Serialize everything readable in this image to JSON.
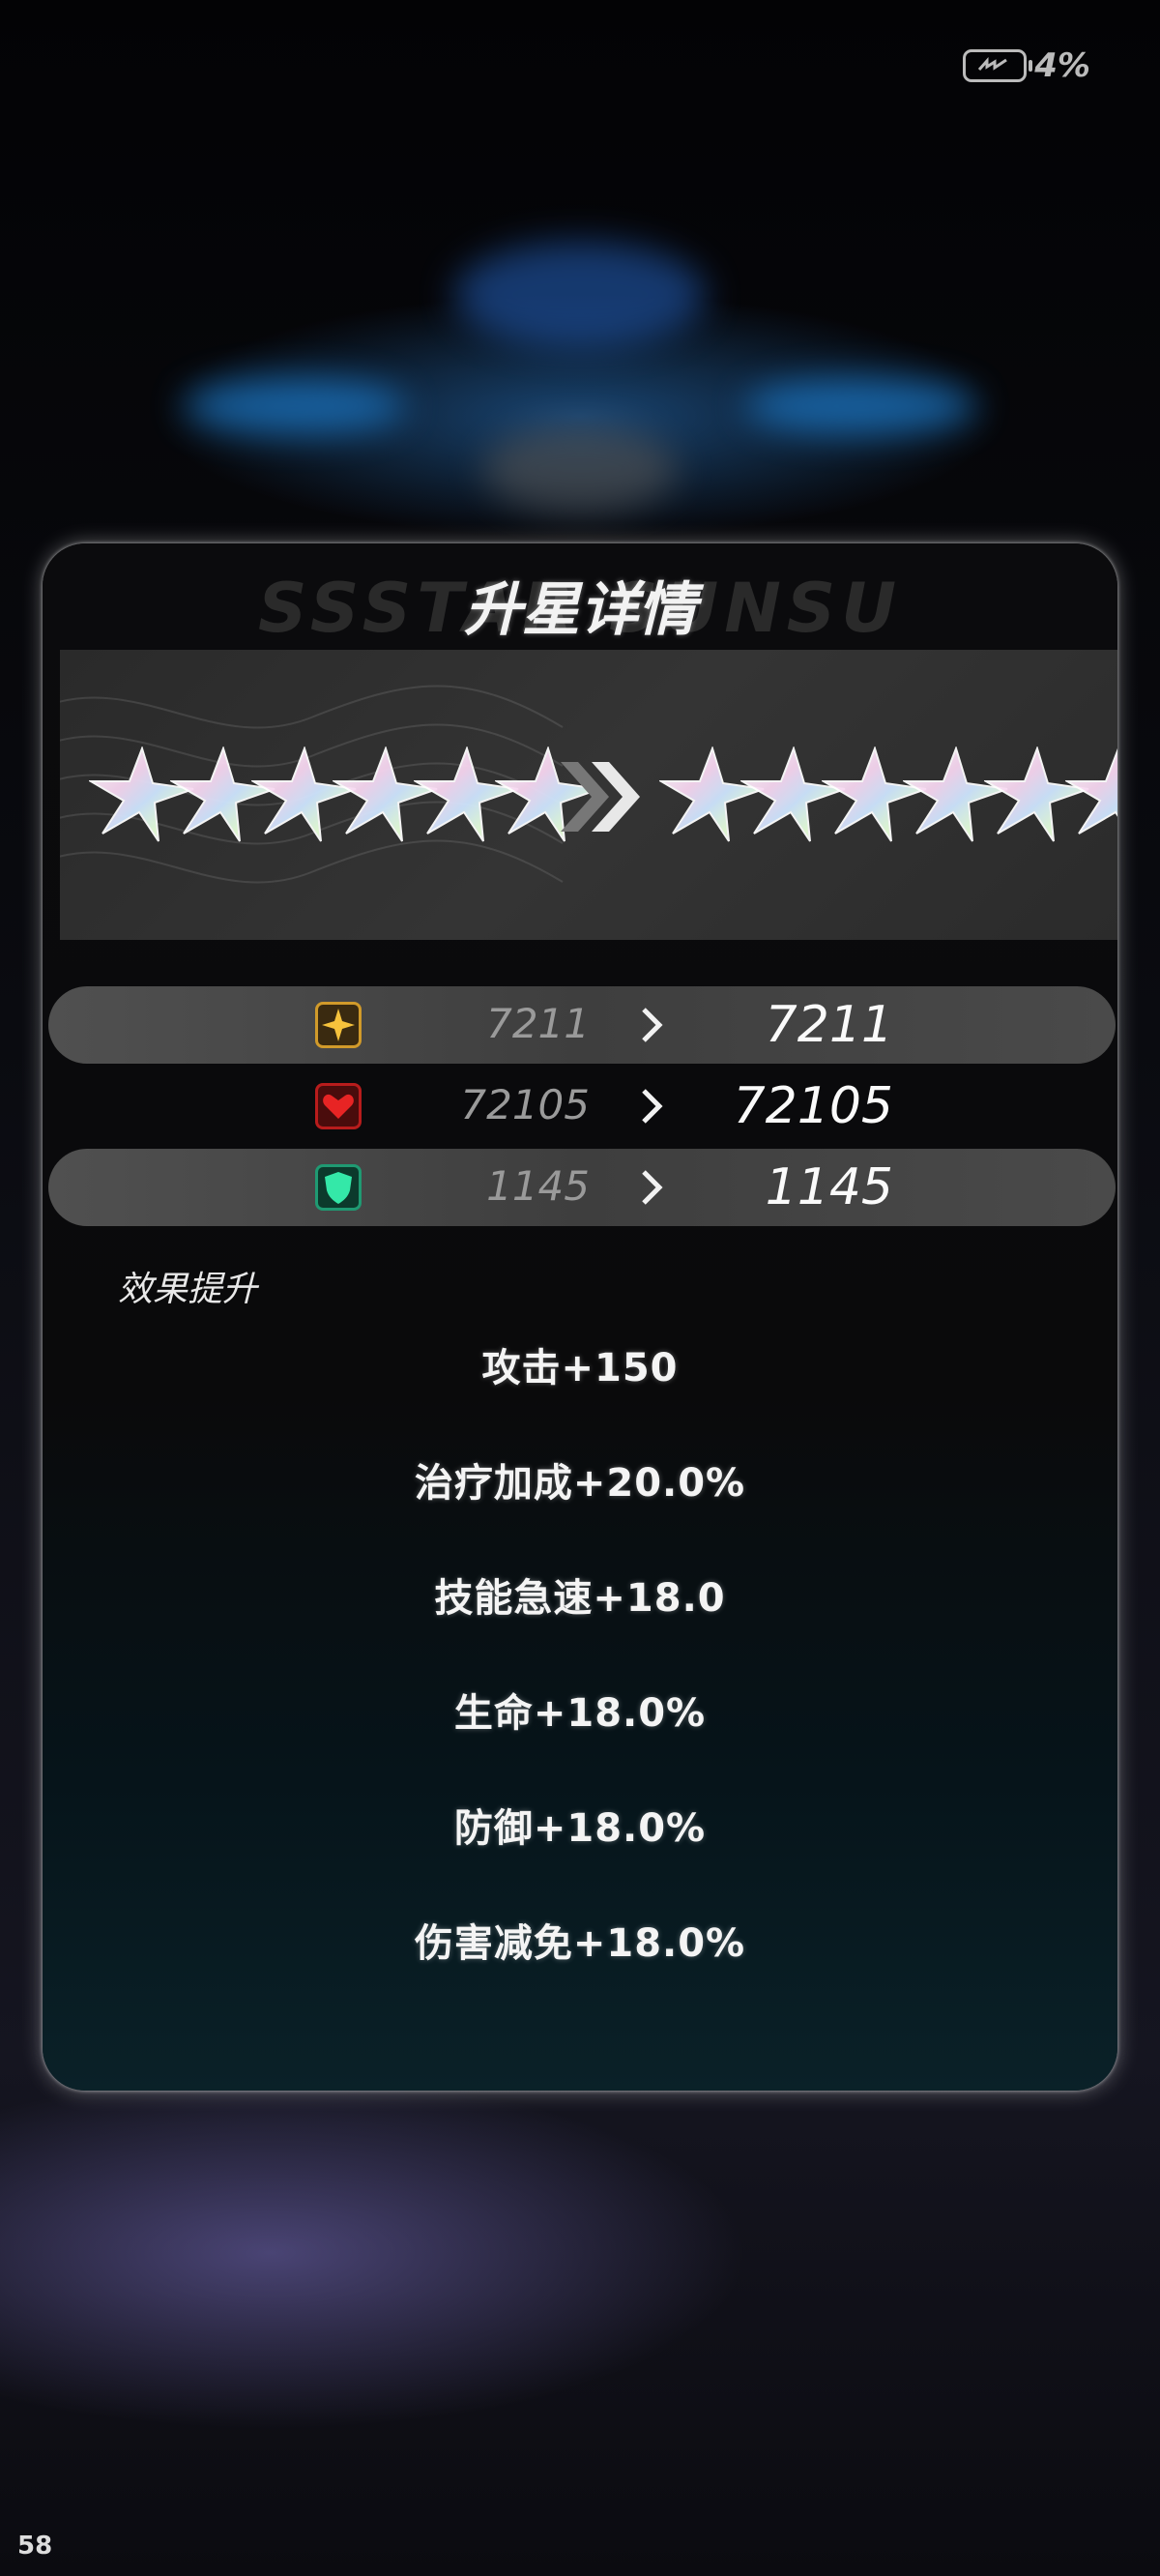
{
  "status_bar": {
    "battery_percent": "4%"
  },
  "fps_counter": "58",
  "panel": {
    "title": "升星详情",
    "title_bg_text": "SSSTAR SUNSU",
    "stars_from": 6,
    "stars_to": 6,
    "stats": [
      {
        "icon": "attack-icon",
        "old": "7211",
        "new": "7211",
        "highlight": true
      },
      {
        "icon": "health-icon",
        "old": "72105",
        "new": "72105",
        "highlight": false
      },
      {
        "icon": "defense-icon",
        "old": "1145",
        "new": "1145",
        "highlight": true
      }
    ],
    "effect_heading": "效果提升",
    "effects": [
      "攻击+150",
      "治疗加成+20.0%",
      "技能急速+18.0",
      "生命+18.0%",
      "防御+18.0%",
      "伤害减免+18.0%"
    ]
  },
  "colors": {
    "attack_icon": "#f0b030",
    "health_icon": "#e02020",
    "defense_icon": "#30e0a0"
  }
}
